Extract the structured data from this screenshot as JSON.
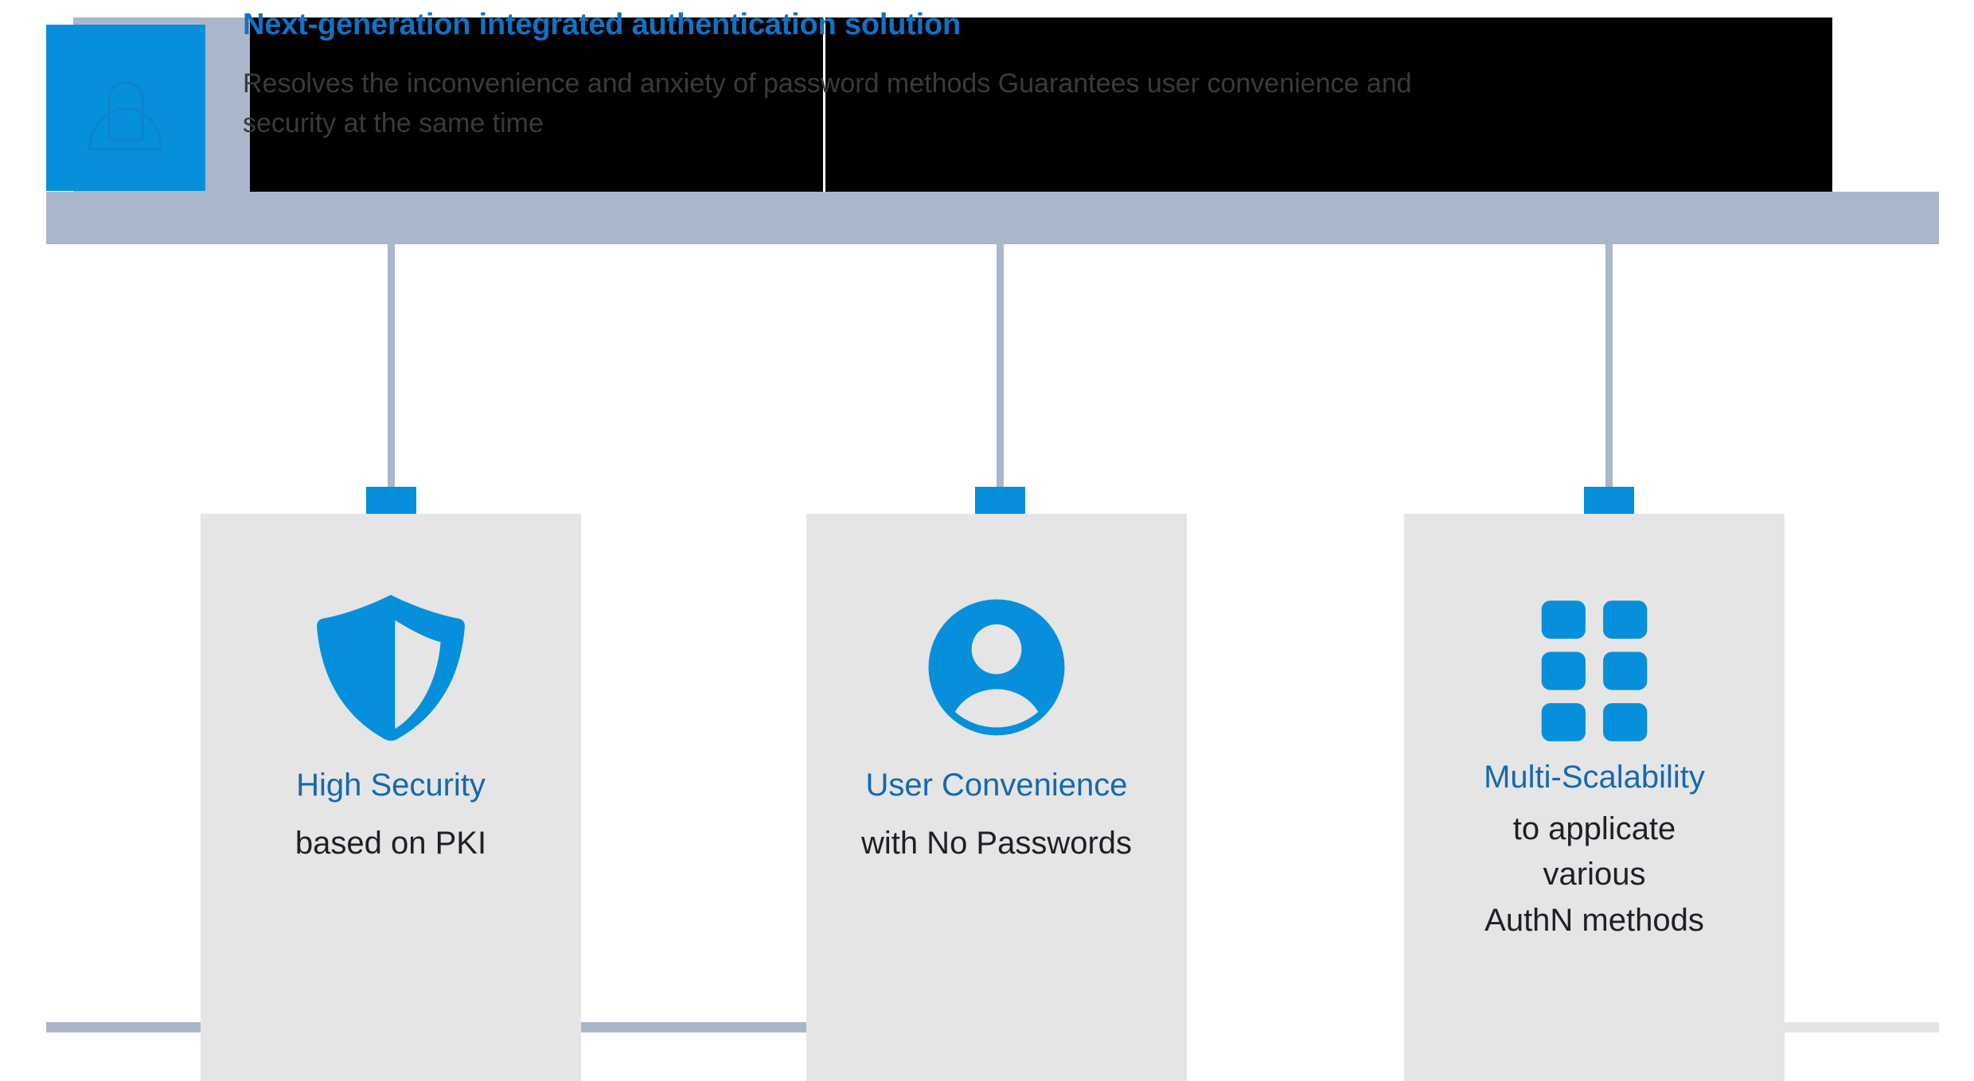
{
  "header": {
    "title": "Next-generation integrated authentication solution",
    "body_line1": "Resolves the inconvenience and anxiety of password methods Guarantees user convenience and",
    "body_line2": "security at the same time",
    "badge_icon": "lock-icon"
  },
  "colors": {
    "accent_blue": "#0690DC",
    "heading_blue": "#1568B0",
    "title_blue": "#1272C4",
    "band_blue_gray": "#AAB6CA",
    "card_gray": "#E5E5E5",
    "body_text": "#3A3A3A",
    "card_text": "#1F1F28",
    "panel_black": "#000000"
  },
  "cards": [
    {
      "icon": "shield-icon",
      "heading": "High Security",
      "subtitle_lines": [
        "based on PKI"
      ]
    },
    {
      "icon": "user-icon",
      "heading": "User Convenience",
      "subtitle_lines": [
        "with No Passwords"
      ]
    },
    {
      "icon": "grid-icon",
      "heading": "Multi-Scalability",
      "subtitle_lines": [
        "to applicate",
        "various",
        "AuthN methods"
      ]
    }
  ]
}
